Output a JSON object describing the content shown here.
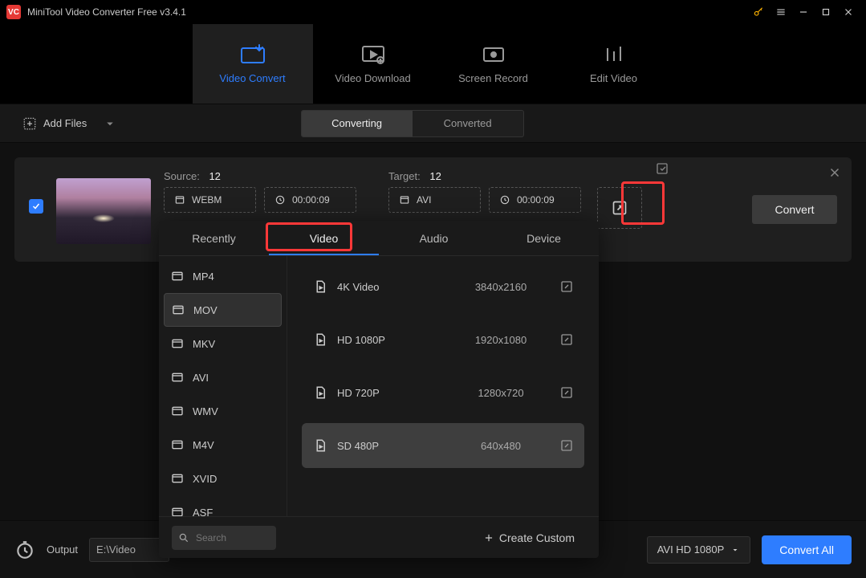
{
  "app": {
    "title": "MiniTool Video Converter Free v3.4.1"
  },
  "modes": {
    "convert": "Video Convert",
    "download": "Video Download",
    "record": "Screen Record",
    "edit": "Edit Video"
  },
  "toolbar": {
    "add": "Add Files",
    "seg_converting": "Converting",
    "seg_converted": "Converted"
  },
  "item": {
    "source_label": "Source:",
    "source_val": "12",
    "src_fmt": "WEBM",
    "src_dur": "00:00:09",
    "target_label": "Target:",
    "target_val": "12",
    "tgt_fmt": "AVI",
    "tgt_dur": "00:00:09",
    "convert": "Convert"
  },
  "popup": {
    "tabs": {
      "recently": "Recently",
      "video": "Video",
      "audio": "Audio",
      "device": "Device"
    },
    "formats": [
      "MP4",
      "MOV",
      "MKV",
      "AVI",
      "WMV",
      "M4V",
      "XVID",
      "ASF"
    ],
    "selected_format_index": 1,
    "resolutions": [
      {
        "name": "4K Video",
        "dim": "3840x2160"
      },
      {
        "name": "HD 1080P",
        "dim": "1920x1080"
      },
      {
        "name": "HD 720P",
        "dim": "1280x720"
      },
      {
        "name": "SD 480P",
        "dim": "640x480"
      }
    ],
    "selected_res_index": 3,
    "search_placeholder": "Search",
    "create": "Create Custom"
  },
  "bottom": {
    "output_label": "Output",
    "output_path": "E:\\Video",
    "preset": "AVI HD 1080P",
    "convert_all": "Convert All"
  }
}
